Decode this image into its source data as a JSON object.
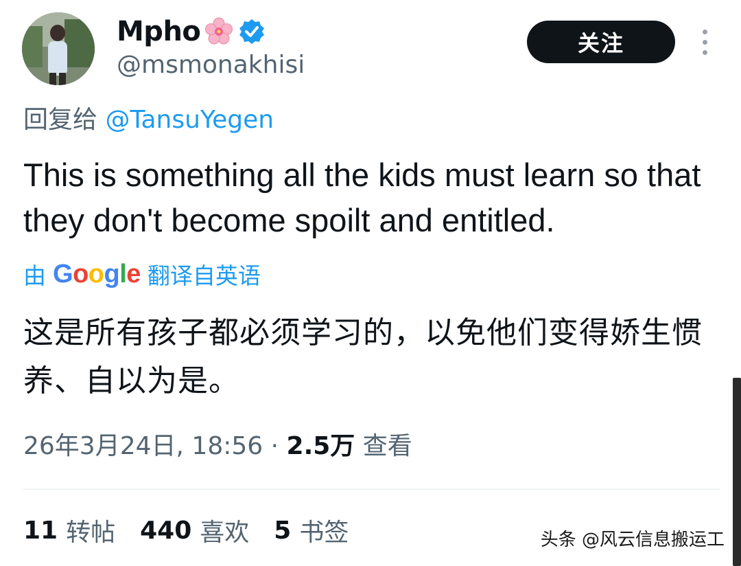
{
  "author": {
    "display_name": "Mpho",
    "name_emoji": "cherry-blossom-emoji",
    "verified_icon": "verified-badge-icon",
    "handle": "@msmonakhisi"
  },
  "actions": {
    "follow_label": "关注",
    "more_icon": "more-vertical-icon"
  },
  "reply": {
    "prefix": "回复给",
    "to": "@TansuYegen"
  },
  "tweet": {
    "text": "This is something all the kids must learn so that they don't become spoilt and entitled.",
    "translation_prefix": "由",
    "translation_brand": "Google",
    "translation_suffix": "翻译自英语",
    "translated_text": "这是所有孩子都必须学习的，以免他们变得娇生惯养、自以为是。"
  },
  "meta": {
    "timestamp": "26年3月24日, 18:56",
    "separator": "·",
    "views_count": "2.5万",
    "views_label": "查看"
  },
  "stats": {
    "retweets_count": "11",
    "retweets_label": "转帖",
    "likes_count": "440",
    "likes_label": "喜欢",
    "bookmarks_count": "5",
    "bookmarks_label": "书签"
  },
  "watermark": "头条 @风云信息搬运工",
  "colors": {
    "link_blue": "#1d9bf0",
    "text_primary": "#0f1419",
    "text_secondary": "#536471",
    "follow_button_bg": "#0f1419"
  }
}
